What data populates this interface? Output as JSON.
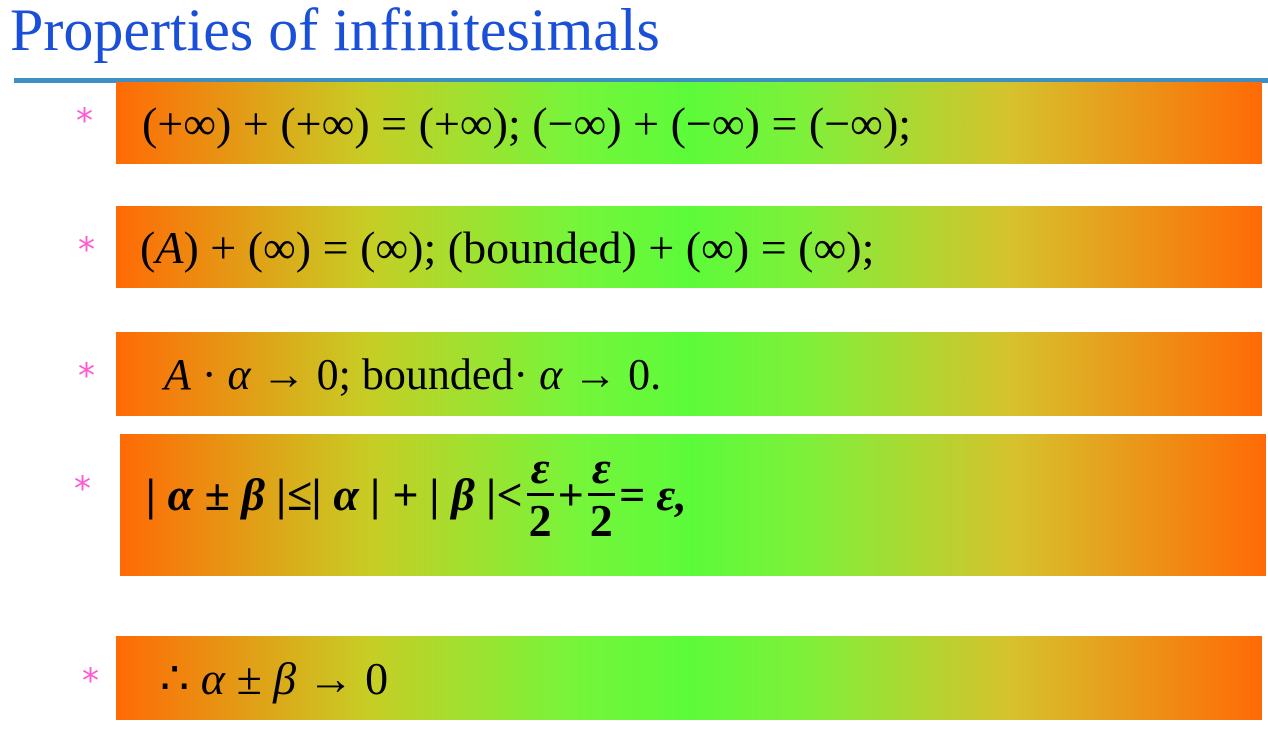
{
  "slide": {
    "title": "Properties of infinitesimals",
    "bullet_symbol": "*"
  },
  "formulas": {
    "f1": "(+∞) + (+∞) = (+∞); (−∞) + (−∞) = (−∞);",
    "f2_a": "(",
    "f2_var": "A",
    "f2_b": ") + (∞) = (∞); (bounded) + (∞) = (∞);",
    "f3_var": "A",
    "f3_b": " · ",
    "f3_alpha": "α",
    "f3_c": " → 0; bounded· ",
    "f3_alpha2": "α",
    "f3_d": " → 0.",
    "f4_lhs": "| α ± β |≤| α | + | β |<",
    "f4_num1": "ε",
    "f4_den1": "2",
    "f4_plus": "+",
    "f4_num2": "ε",
    "f4_den2": "2",
    "f4_rhs": "= ε,",
    "f5_a": "∴ ",
    "f5_b": "α ± β",
    "f5_c": " → 0"
  }
}
